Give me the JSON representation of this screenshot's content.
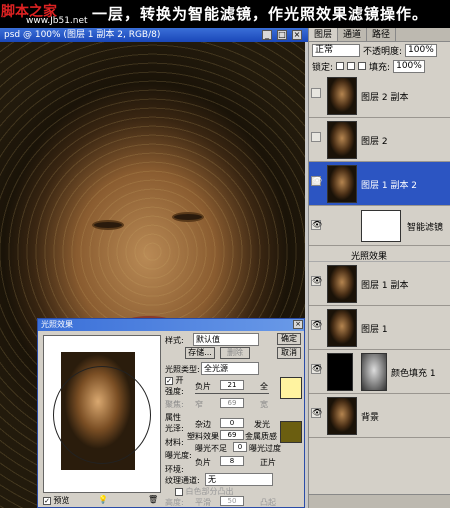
{
  "banner": {
    "site": "脚本之家",
    "site_url": "www.Jb51.net",
    "text": "一层，转换为智能滤镜，作光照效果滤镜操作。"
  },
  "document": {
    "title": "psd @ 100% (图层 1 副本 2, RGB/8)",
    "buttons": [
      "_",
      "□",
      "×"
    ]
  },
  "panel": {
    "tabs": [
      "图层",
      "通道",
      "路径"
    ],
    "blend_mode": "正常",
    "opacity_label": "不透明度:",
    "opacity": "100%",
    "lock_label": "锁定:",
    "fill_label": "填充:",
    "fill": "100%",
    "layers": [
      {
        "name": "图层 2 副本",
        "visible": false,
        "active": false
      },
      {
        "name": "图层 2",
        "visible": false,
        "active": false
      },
      {
        "name": "图层 1 副本 2",
        "visible": true,
        "active": true
      }
    ],
    "smart_filter_label": "智能滤镜",
    "filter_name": "光照效果",
    "layers2": [
      {
        "name": "图层 1 副本",
        "visible": true
      },
      {
        "name": "图层 1",
        "visible": true
      },
      {
        "name": "颜色填充 1",
        "visible": true
      },
      {
        "name": "背景",
        "visible": true
      }
    ]
  },
  "dialog": {
    "title": "光照效果",
    "style_label": "样式:",
    "style_value": "默认值",
    "ok": "确定",
    "cancel": "取消",
    "save": "存储...",
    "delete": "删除",
    "light_type_label": "光照类型:",
    "light_type": "全光源",
    "on_label": "开",
    "intensity_label": "强度:",
    "negative": "负片",
    "intensity_value": "21",
    "full": "全",
    "focus_label": "聚焦:",
    "narrow": "窄",
    "focus_value": "69",
    "wide": "宽",
    "props_label": "属性",
    "gloss_label": "光泽:",
    "matte": "杂边",
    "gloss_value": "0",
    "shiny": "发光",
    "material_label": "材料:",
    "plastic": "塑料效果",
    "material_value": "69",
    "metallic": "金属质感",
    "exposure_label": "曝光度:",
    "under": "曝光不足",
    "exposure_value": "0",
    "over": "曝光过度",
    "ambience_label": "环境:",
    "ambience_value": "8",
    "positive": "正片",
    "texture_label": "纹理通道:",
    "texture_value": "无",
    "white_high": "白色部分凸出",
    "height_label": "高度:",
    "flat": "平滑",
    "height_value": "50",
    "mountainous": "凸起",
    "preview_label": "预览",
    "light_color": "#fff3a0",
    "ambient_color": "#6b5e10"
  },
  "colors": {
    "titlebar": "#2c55c2",
    "dialog_bg": "#d4d0c8"
  }
}
